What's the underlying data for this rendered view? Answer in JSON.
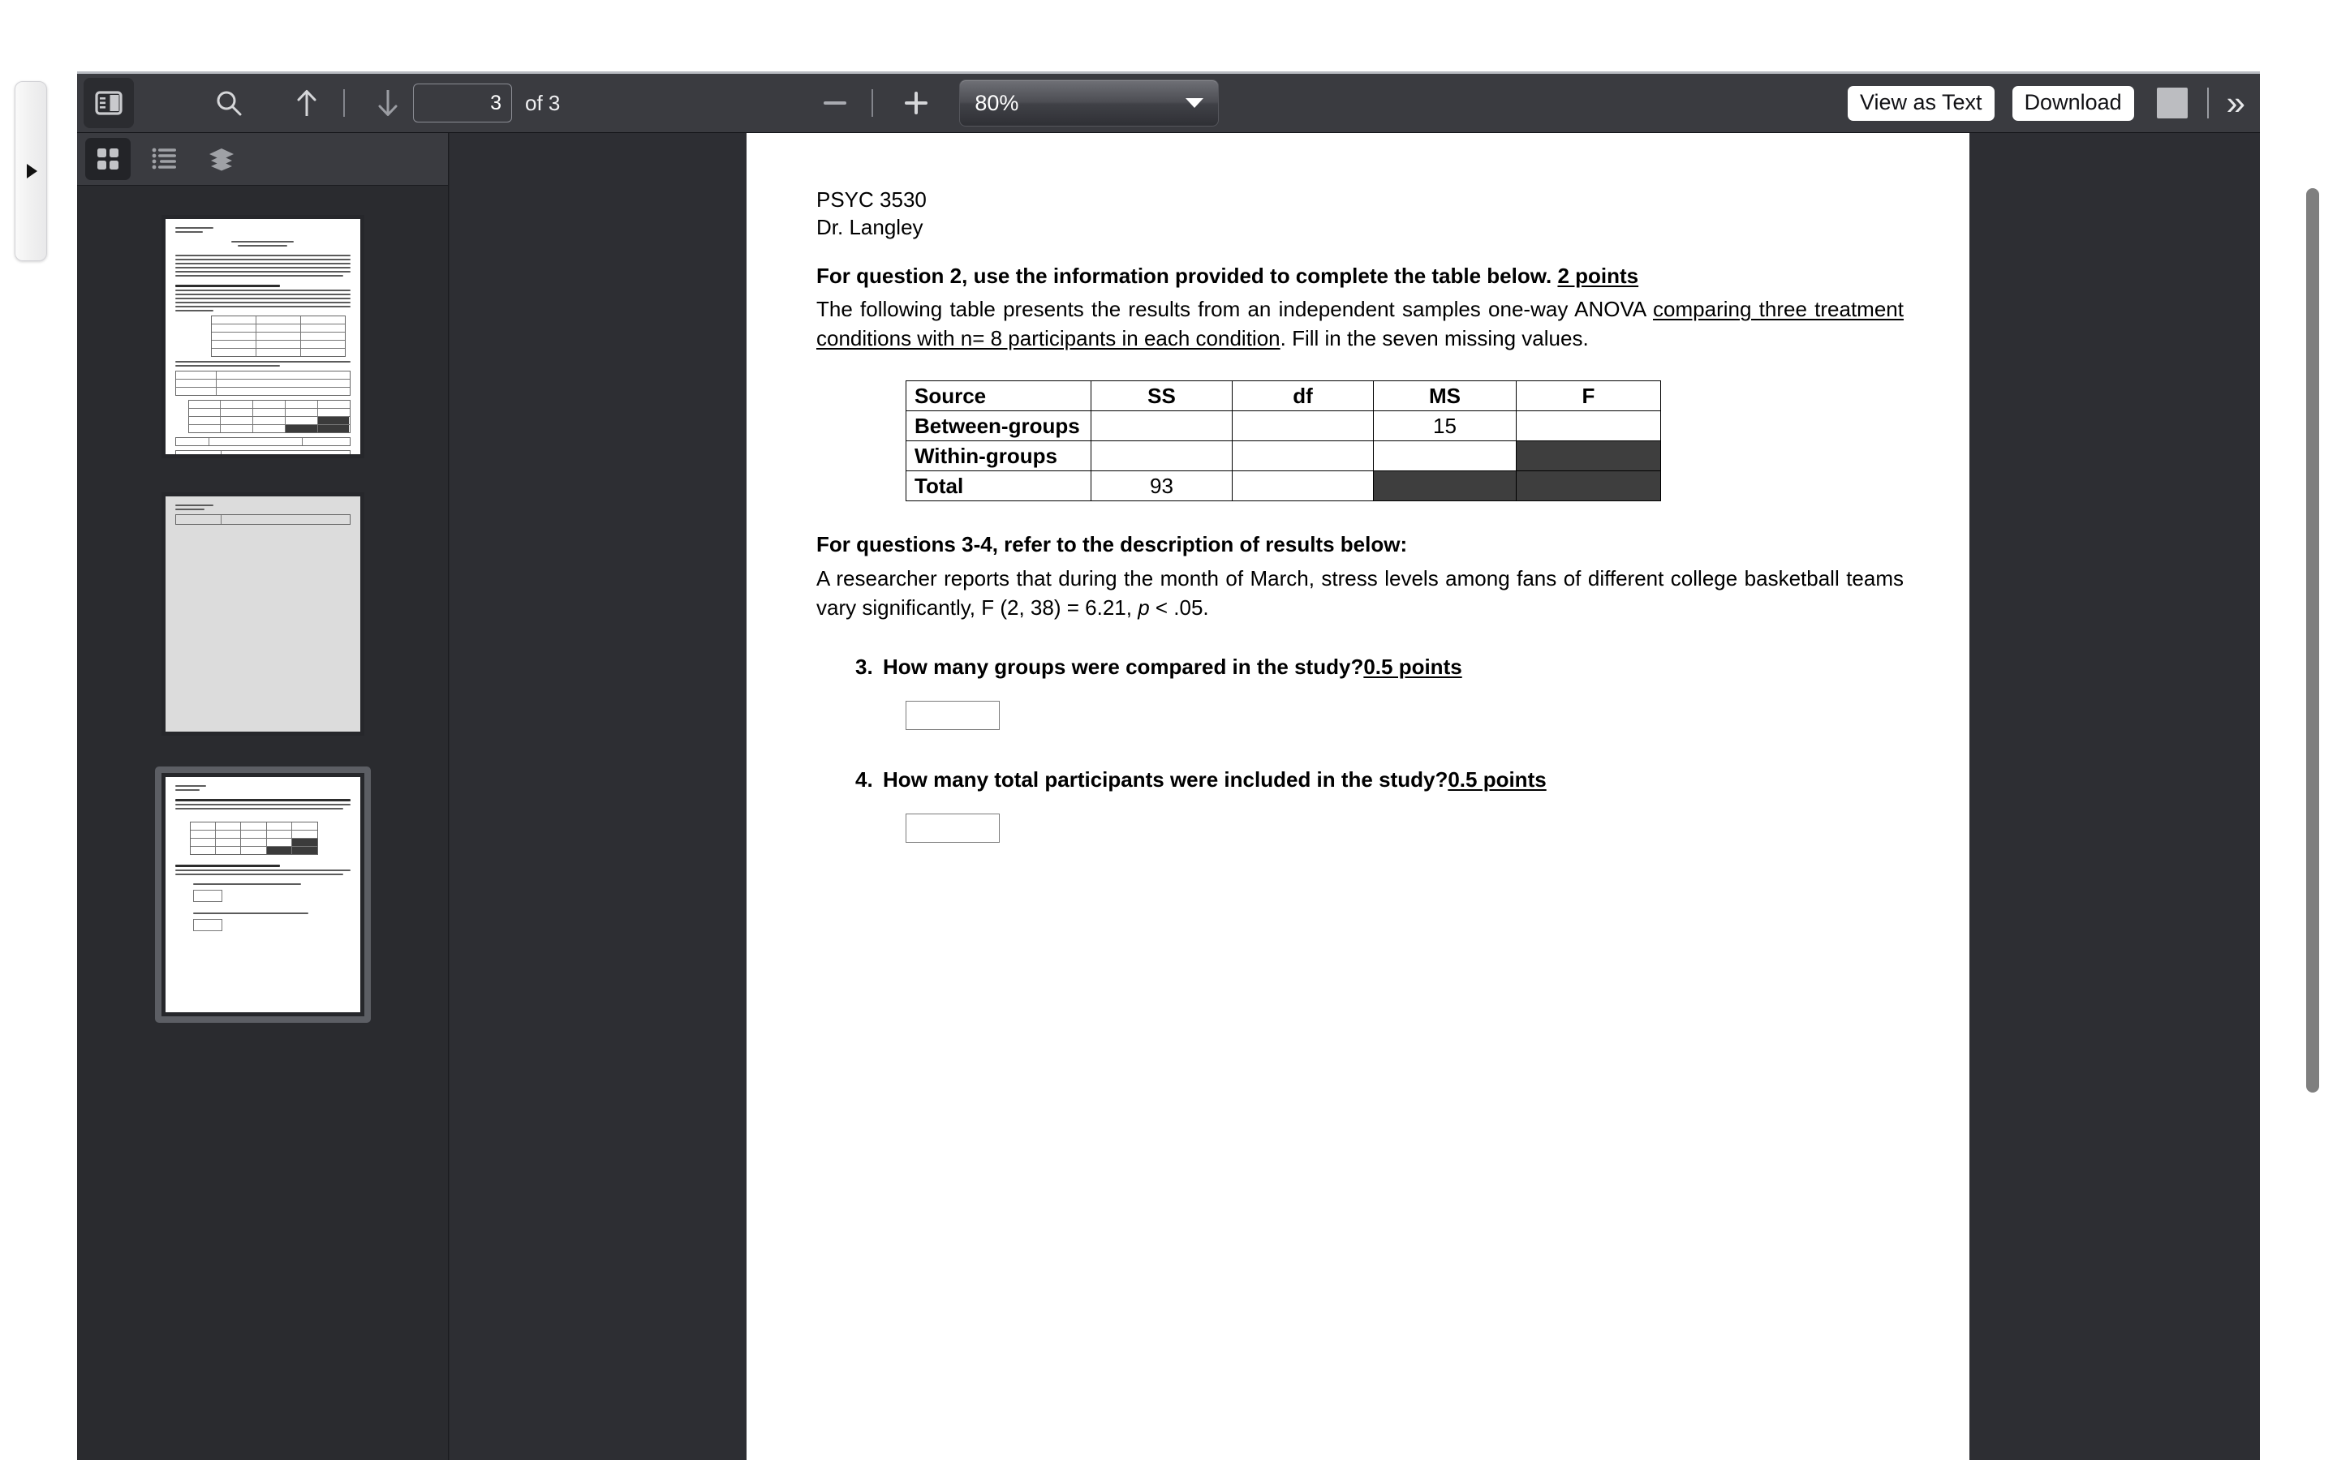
{
  "window": {
    "edge_handle_icon": "triangle-right-icon"
  },
  "toolbar": {
    "sidebar_toggle_icon": "sidebar-panel-icon",
    "search_icon": "search-icon",
    "prev_icon": "arrow-up-icon",
    "next_icon": "arrow-down-icon",
    "page_number": "3",
    "page_total_label": "of 3",
    "zoom_out_icon": "minus-icon",
    "zoom_in_icon": "plus-icon",
    "zoom_value": "80%",
    "zoom_dropdown_icon": "chevron-down-icon",
    "view_as_text_label": "View as Text",
    "download_label": "Download",
    "window_square_icon": "square-icon",
    "overflow_icon": "double-chevron-right-icon"
  },
  "sidebar": {
    "tools": [
      {
        "name": "thumbnails-view",
        "icon": "grid-icon",
        "active": true
      },
      {
        "name": "outline-view",
        "icon": "list-icon",
        "active": false
      },
      {
        "name": "layers-view",
        "icon": "layers-icon",
        "active": false
      }
    ],
    "thumbnails": [
      {
        "page": "1",
        "selected": false
      },
      {
        "page": "2",
        "selected": false
      },
      {
        "page": "3",
        "selected": true
      }
    ]
  },
  "document": {
    "course": "PSYC 3530",
    "instructor": "Dr. Langley",
    "q2_heading_plain": "For question 2, use the information provided to complete the table below. ",
    "q2_heading_points": "2 points",
    "q2_body_part1": "The following table presents the results from an independent samples one-way ANOVA ",
    "q2_body_underlined": "comparing three treatment conditions with n= 8 participants in each condition",
    "q2_body_part2": ". Fill in the seven missing values.",
    "q34_heading": "For questions 3-4, refer to the description of results below:",
    "q34_body": "A researcher reports that during the month of March, stress levels among fans of different college basketball teams vary significantly, F (2, 38) = 6.21, p < .05.",
    "q34_body_lead": "A researcher reports that during the month of March, stress levels among fans of different college basketball teams vary significantly, F (2, 38) = 6.21, ",
    "q34_body_italic": "p",
    "q34_body_tail": " < .05.",
    "questions": [
      {
        "number": "3.",
        "text": "How many groups were compared in the study? ",
        "points": "0.5 points",
        "answer": ""
      },
      {
        "number": "4.",
        "text": "How many total participants were included in the study? ",
        "points": "0.5 points",
        "answer": ""
      }
    ]
  },
  "chart_data": {
    "type": "table",
    "title": "One-way ANOVA summary table",
    "columns": [
      "Source",
      "SS",
      "df",
      "MS",
      "F"
    ],
    "rows": [
      {
        "Source": "Between-groups",
        "SS": "",
        "df": "",
        "MS": "15",
        "F": ""
      },
      {
        "Source": "Within-groups",
        "SS": "",
        "df": "",
        "MS": "",
        "F": "__BLACK__"
      },
      {
        "Source": "Total",
        "SS": "93",
        "df": "",
        "MS": "__BLACK__",
        "F": "__BLACK__"
      }
    ],
    "blocked_cells": [
      [
        "Within-groups",
        "F"
      ],
      [
        "Total",
        "MS"
      ],
      [
        "Total",
        "F"
      ]
    ],
    "missing_value_count": 7
  },
  "colors": {
    "toolbar_bg": "#3a3b40",
    "sidebar_bg": "#2a2b2f",
    "canvas_bg": "#2d2e33",
    "page_bg": "#ffffff",
    "blocked_cell": "#3e3e3e",
    "scrollbar": "#7f7f7f",
    "selection": "#5c5e64"
  }
}
